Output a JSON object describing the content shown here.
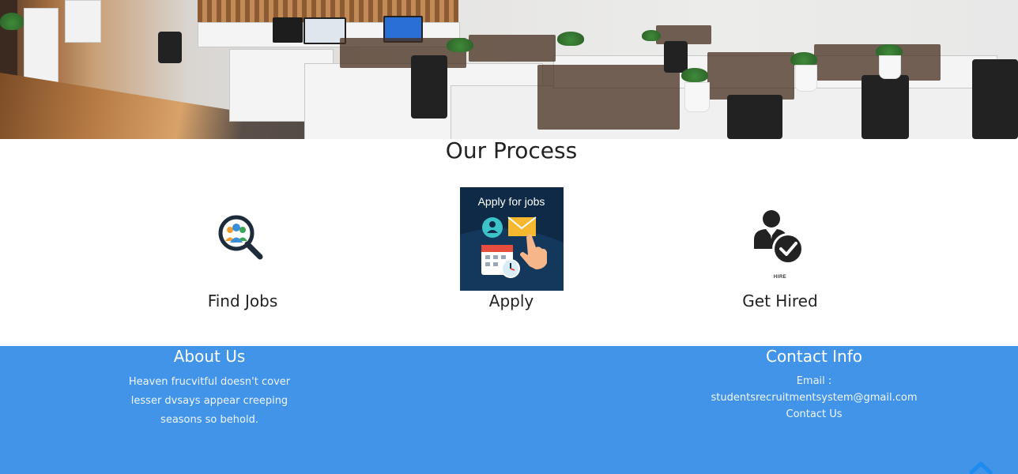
{
  "process": {
    "title": "Our Process",
    "steps": [
      {
        "label": "Find Jobs",
        "icon": "find-jobs-icon"
      },
      {
        "label": "Apply",
        "icon": "apply-for-jobs-image",
        "image_caption": "Apply for jobs"
      },
      {
        "label": "Get Hired",
        "icon": "get-hired-icon",
        "image_caption": "HIRE"
      }
    ]
  },
  "footer": {
    "background": "#4194e8",
    "about": {
      "title": "About Us",
      "text": "Heaven frucvitful doesn't cover lesser dvsays appear creeping seasons so behold."
    },
    "contact": {
      "title": "Contact Info",
      "email_label": "Email :",
      "email": "studentsrecruitmentsystem@gmail.com",
      "link": "Contact Us"
    }
  },
  "back_to_top_icon": "chevron-up-icon"
}
